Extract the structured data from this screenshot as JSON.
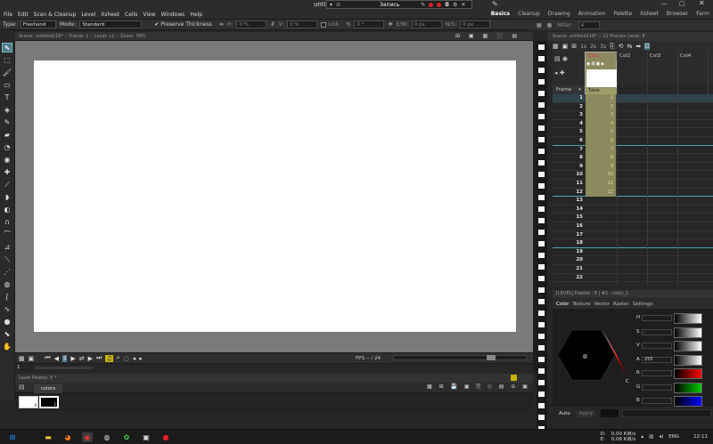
{
  "window": {
    "title": "unti"
  },
  "recorder": {
    "label": "Запись"
  },
  "menu": [
    "File",
    "Edit",
    "Scan & Cleanup",
    "Level",
    "Xsheet",
    "Cells",
    "View",
    "Windows",
    "Help"
  ],
  "rooms": [
    {
      "label": "Basics",
      "active": true
    },
    {
      "label": "Cleanup",
      "active": false
    },
    {
      "label": "Drawing",
      "active": false
    },
    {
      "label": "Animation",
      "active": false
    },
    {
      "label": "Palette",
      "active": false
    },
    {
      "label": "Xsheet",
      "active": false
    },
    {
      "label": "Browser",
      "active": false
    },
    {
      "label": "Farm",
      "active": false
    }
  ],
  "tool_options": {
    "type_label": "Type:",
    "type_value": "Freehand",
    "mode_label": "Mode:",
    "mode_value": "Standard",
    "preserve_thickness": "Preserve Thickness",
    "h_label": "H:",
    "h_value": "0 %",
    "v_label": "V:",
    "v_value": "0 %",
    "link": "Link",
    "angle_value": "0 °",
    "ew_label": "E/W:",
    "ew_value": "0 px",
    "ns_label": "N/S:",
    "ns_value": "0 px"
  },
  "xsheet_options": {
    "miter_label": "Miter:",
    "miter_value": "4"
  },
  "viewer": {
    "header": "Scene: untitled118* :: Frame: 1 :: Level: L1 :: Zoom: 58%"
  },
  "flipbar": {
    "fps_label": "FPS -- / 24"
  },
  "frame_field": {
    "value": "1"
  },
  "level_palette": {
    "header": "Level Palette: E *",
    "tab": "colors"
  },
  "xsheet": {
    "header": "Scene: untitled118*  ::  12 Frames  Level: E",
    "frame_col_label": "Frame",
    "columns": [
      "Col1",
      "Col2",
      "Col3",
      "Col4"
    ],
    "col1_level": "Table",
    "frames": [
      "1",
      "2",
      "3",
      "4",
      "5",
      "6",
      "7",
      "8",
      "9",
      "10",
      "11",
      "12",
      "13",
      "14",
      "15",
      "16",
      "17",
      "18",
      "19",
      "20",
      "21",
      "22"
    ],
    "cells": [
      "1",
      "2",
      "3",
      "4",
      "5",
      "6",
      "7",
      "8",
      "9",
      "10",
      "11",
      "12"
    ]
  },
  "style_editor": {
    "header": "[LEVEL] Palette : E | #1 : color_1",
    "tabs": [
      {
        "label": "Color",
        "active": true
      },
      {
        "label": "Texture",
        "active": false
      },
      {
        "label": "Vector",
        "active": false
      },
      {
        "label": "Raster",
        "active": false
      },
      {
        "label": "Settings",
        "active": false
      }
    ],
    "channels": [
      {
        "label": "H"
      },
      {
        "label": "S"
      },
      {
        "label": "V"
      },
      {
        "label": "A",
        "value": "255"
      },
      {
        "label": "R"
      },
      {
        "label": "G"
      },
      {
        "label": "B"
      }
    ],
    "auto": "Auto",
    "apply": "Apply"
  },
  "taskbar": {
    "disk_d": "D:",
    "disk_e": "E:",
    "net_up": "0,00 KiB/s",
    "net_down": "0,06 KiB/s",
    "lang": "ENG",
    "time": "12:11"
  },
  "colors": {
    "accent": "#4f7a8e",
    "cell": "#8a8a5e",
    "canvas": "#ffffff",
    "viewer_bg": "#7a7a7a"
  }
}
